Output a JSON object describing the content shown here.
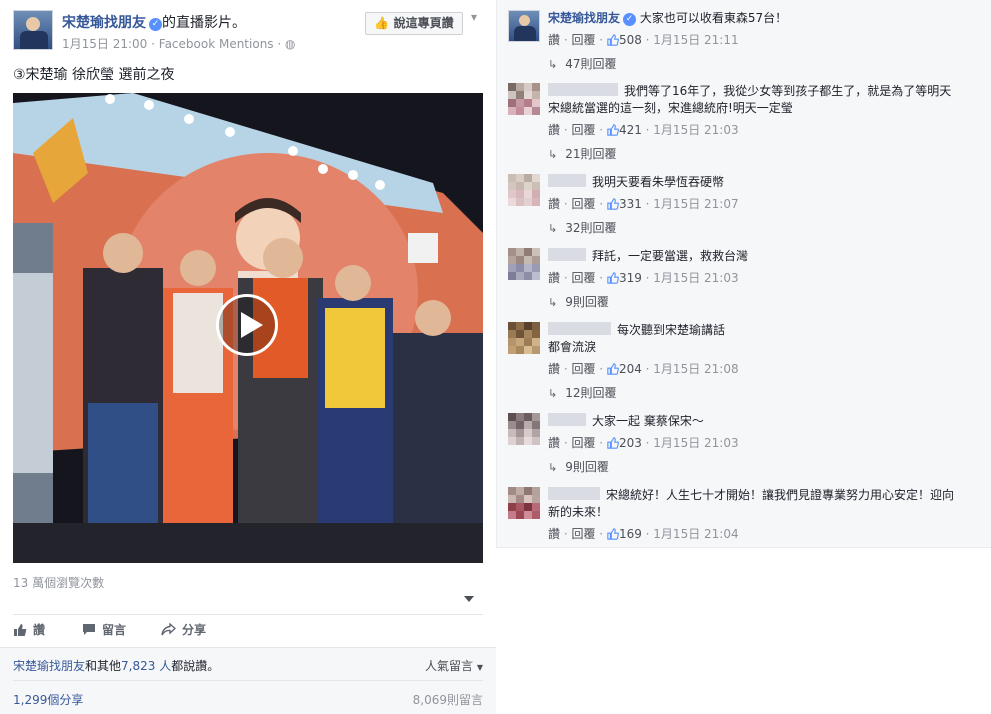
{
  "post": {
    "page_name": "宋楚瑜找朋友",
    "after_name": "的直播影片。",
    "date": "1月15日 21:00",
    "source": "Facebook Mentions",
    "like_page_button": "說這專頁讚",
    "text": "③宋楚瑜 徐欣瑩 選前之夜",
    "views": "13 萬個瀏覽次數",
    "actions": {
      "like": "讚",
      "comment": "留言",
      "share": "分享"
    },
    "likes_prefix": "宋楚瑜找朋友",
    "likes_mid": "和其他",
    "likes_count": "7,823 人",
    "likes_suffix": "都說讚。",
    "sort_label": "人氣留言",
    "shares": "1,299個分享",
    "comments_total": "8,069則留言"
  },
  "comments": [
    {
      "author": "宋楚瑜找朋友",
      "text": "大家也可以收看東森57台！",
      "like": "讚",
      "reply": "回覆",
      "likes": "508",
      "time": "1月15日 21:11",
      "replies": "47則回覆"
    },
    {
      "text": "我們等了16年了，我從少女等到孩子都生了，就是為了等明天宋總統當選的這一刻，宋進總統府!明天一定瑩",
      "like": "讚",
      "reply": "回覆",
      "likes": "421",
      "time": "1月15日 21:03",
      "replies": "21則回覆"
    },
    {
      "text": "我明天要看朱學恆吞硬幣",
      "like": "讚",
      "reply": "回覆",
      "likes": "331",
      "time": "1月15日 21:07",
      "replies": "32則回覆"
    },
    {
      "text": "拜託，一定要當選，救救台灣",
      "like": "讚",
      "reply": "回覆",
      "likes": "319",
      "time": "1月15日 21:03",
      "replies": "9則回覆"
    },
    {
      "text_line1": "每次聽到宋楚瑜講話",
      "text_line2": "都會流淚",
      "like": "讚",
      "reply": "回覆",
      "likes": "204",
      "time": "1月15日 21:08",
      "replies": "12則回覆"
    },
    {
      "text": "大家一起 棄蔡保宋～",
      "like": "讚",
      "reply": "回覆",
      "likes": "203",
      "time": "1月15日 21:03",
      "replies": "9則回覆"
    },
    {
      "text": "宋總統好！人生七十才開始！讓我們見證專業努力用心安定！迎向新的未來！",
      "like": "讚",
      "reply": "回覆",
      "likes": "169",
      "time": "1月15日 21:04"
    }
  ],
  "colors": {
    "link": "#365899",
    "meta": "#90949c",
    "verified": "#5890ff"
  }
}
